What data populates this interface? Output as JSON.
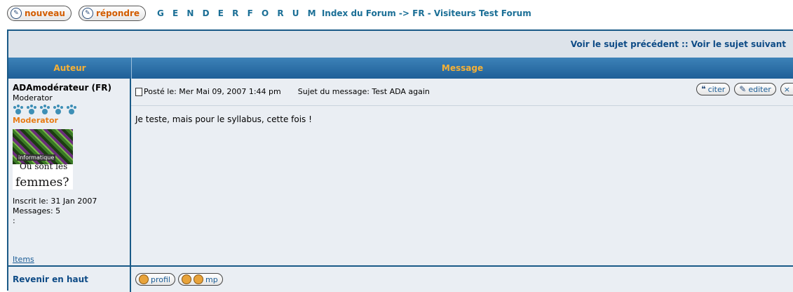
{
  "toolbar": {
    "new_label": "nouveau",
    "reply_label": "répondre"
  },
  "breadcrumb": {
    "site": "G E N D E R F O R U M",
    "index": "Index du Forum",
    "arrow": "->",
    "forum": "FR - Visiteurs Test Forum"
  },
  "topic_nav": {
    "prev": "Voir le sujet précédent",
    "sep": "::",
    "next": "Voir le sujet suivant"
  },
  "table_head": {
    "author": "Auteur",
    "message": "Message"
  },
  "post": {
    "author_name": "ADAmodérateur (FR)",
    "author_rank": "Moderator",
    "rank_title": "Moderator",
    "avatar_text_top": "informatique",
    "avatar_text_mid": "Où sont les",
    "avatar_text_bottom": "femmes?",
    "joined": "Inscrit le: 31 Jan 2007",
    "messages": "Messages: 5",
    "extra": ":",
    "items": "Items",
    "posted": "Posté le: Mer Mai 09, 2007 1:44 pm",
    "subject": "Sujet du message: Test ADA again",
    "body": "Je teste, mais pour le syllabus, cette fois !",
    "quote_label": "citer",
    "edit_label": "editer",
    "delete_label": "×"
  },
  "footer": {
    "back_to_top": "Revenir en haut",
    "profile_label": "profil",
    "pm_label": "mp"
  }
}
